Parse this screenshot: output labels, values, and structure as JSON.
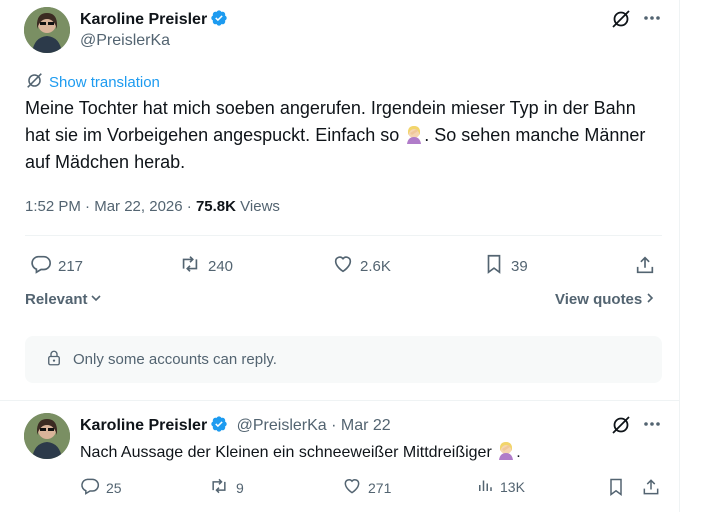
{
  "main_tweet": {
    "author_name": "Karoline Preisler",
    "author_handle": "@PreislerKa",
    "show_translation": "Show translation",
    "text_before_emoji": "Meine Tochter hat mich soeben angerufen. Irgendein mieser Typ in der Bahn hat sie im Vorbeigehen angespuckt. Einfach so",
    "text_after_emoji": ". So sehen manche Männer auf Mädchen herab.",
    "time": "1:52 PM",
    "date": "Mar 22, 2026",
    "views_count": "75.8K",
    "views_label": "Views",
    "replies": "217",
    "reposts": "240",
    "likes": "2.6K",
    "bookmarks": "39",
    "relevant_label": "Relevant",
    "view_quotes_label": "View quotes",
    "reply_restriction": "Only some accounts can reply."
  },
  "reply_tweet": {
    "author_name": "Karoline Preisler",
    "author_handle": "@PreislerKa",
    "date": "Mar 22",
    "text_before_emoji": "Nach Aussage der Kleinen ein schneeweißer Mittdreißiger",
    "text_after_emoji": ".",
    "replies": "25",
    "reposts": "9",
    "likes": "271",
    "views": "13K"
  },
  "colors": {
    "accent": "#1d9bf0",
    "text_primary": "#0f1419",
    "text_secondary": "#536471",
    "notice_bg": "#f7f9f9"
  }
}
